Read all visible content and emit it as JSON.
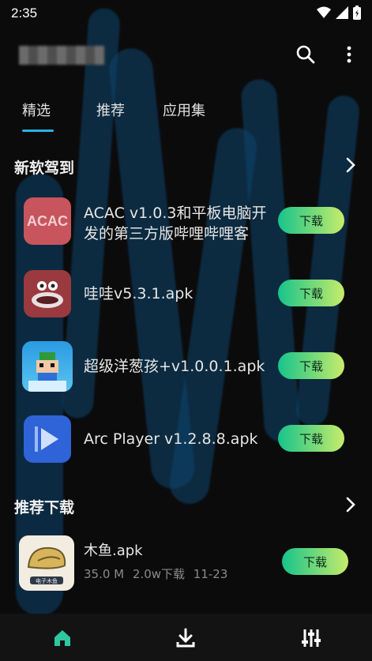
{
  "status": {
    "time": "2:35"
  },
  "tabs": [
    {
      "label": "精选"
    },
    {
      "label": "推荐"
    },
    {
      "label": "应用集"
    }
  ],
  "sections": {
    "new_apps": {
      "title": "新软驾到",
      "items": [
        {
          "name": "ACAC v1.0.3和平板电脑开发的第三方版哔哩哔哩客",
          "icon_text": "ACAC",
          "button": "下载"
        },
        {
          "name": "哇哇v5.3.1.apk",
          "button": "下载"
        },
        {
          "name": "超级洋葱孩+v1.0.0.1.apk",
          "button": "下载"
        },
        {
          "name": "Arc Player v1.2.8.8.apk",
          "button": "下载"
        }
      ]
    },
    "recommended": {
      "title": "推荐下载",
      "items": [
        {
          "name": "木鱼.apk",
          "icon_text": "电子木鱼",
          "size": "35.0 M",
          "downloads": "2.0w下载",
          "date": "11-23",
          "button": "下载"
        }
      ]
    }
  },
  "icons": {
    "search": "search-icon",
    "more": "more-vert-icon",
    "chevron": "chevron-right-icon",
    "nav_home": "home-icon",
    "nav_download": "download-icon",
    "nav_manage": "tune-icon"
  },
  "colors": {
    "accent": "#27b3e6",
    "button_start": "#16c48b",
    "button_end": "#c7ec6a",
    "nav_active": "#2ec7a0"
  }
}
